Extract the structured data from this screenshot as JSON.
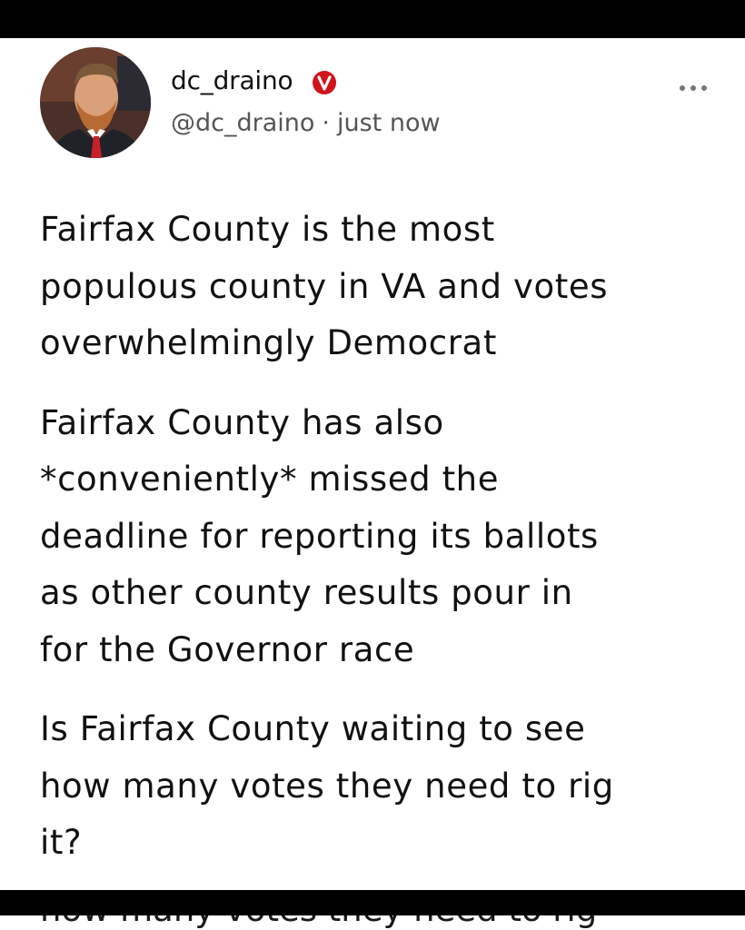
{
  "post": {
    "author": {
      "display_name": "dc_draino",
      "handle": "@dc_draino",
      "separator": "·",
      "timestamp": "just now",
      "verified_badge_icon": "verified-v-badge",
      "verified_color": "#d0121a"
    },
    "more_icon": "ellipsis-icon",
    "paragraphs": [
      "Fairfax County is the most\npopulous county in VA and votes\noverwhelmingly Democrat",
      "Fairfax County has also\n*conveniently* missed the\ndeadline for reporting its ballots\nas other county results pour in\nfor the Governor race",
      "Is Fairfax County waiting to see\nhow many votes they need to rig\nit?"
    ],
    "cut_off_line": "how many votes they need to rig"
  }
}
